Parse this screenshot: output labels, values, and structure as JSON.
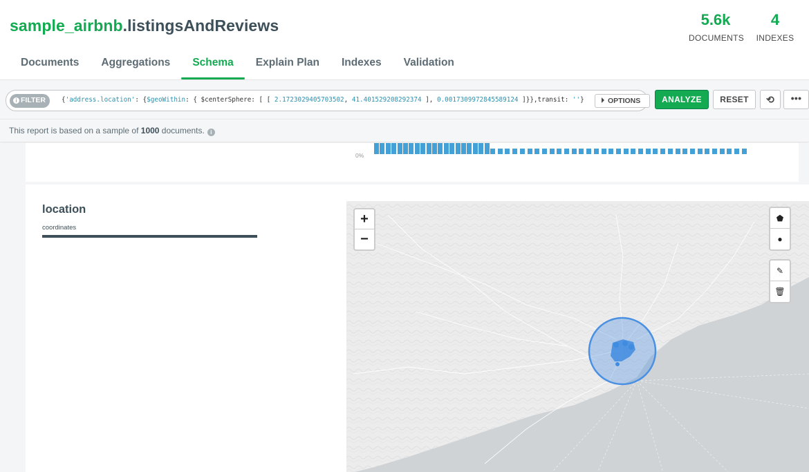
{
  "namespace": {
    "database": "sample_airbnb",
    "collection": ".listingsAndReviews"
  },
  "stats": [
    {
      "value": "5.6k",
      "label": "DOCUMENTS"
    },
    {
      "value": "4",
      "label": "INDEXES"
    }
  ],
  "tabs": [
    {
      "label": "Documents",
      "active": false
    },
    {
      "label": "Aggregations",
      "active": false
    },
    {
      "label": "Schema",
      "active": true
    },
    {
      "label": "Explain Plan",
      "active": false
    },
    {
      "label": "Indexes",
      "active": false
    },
    {
      "label": "Validation",
      "active": false
    }
  ],
  "toolbar": {
    "filter_label": "FILTER",
    "query": {
      "p1": "{",
      "p2": "'address.location'",
      "p3": ": {",
      "p4": "$geoWithin",
      "p5": ": { $centerSphere: [ [ ",
      "p6": "2.1723029405703502",
      "p7": ", ",
      "p8": "41.401529208292374",
      "p9": " ], ",
      "p10": "0.0017309972845589124",
      "p11": " ]}},transit: ",
      "p12": "''",
      "p13": "}"
    },
    "options_label": "OPTIONS",
    "analyze_label": "ANALYZE",
    "reset_label": "RESET",
    "history_icon": "history-icon",
    "more_icon": "ellipsis-icon"
  },
  "sample_info": {
    "prefix": "This report is based on a sample of ",
    "count": "1000",
    "suffix": " documents."
  },
  "top_card": {
    "pct_label": "0%"
  },
  "location_field": {
    "name": "location",
    "type_label": "coordinates",
    "map": {
      "zoom_in": "+",
      "zoom_out": "−",
      "colors": {
        "circle": "#4a90e2",
        "points": "#3f8ce0",
        "sea": "#cfd3d6"
      }
    }
  },
  "colors": {
    "accent": "#13aa52",
    "bar": "#43a1d8"
  }
}
